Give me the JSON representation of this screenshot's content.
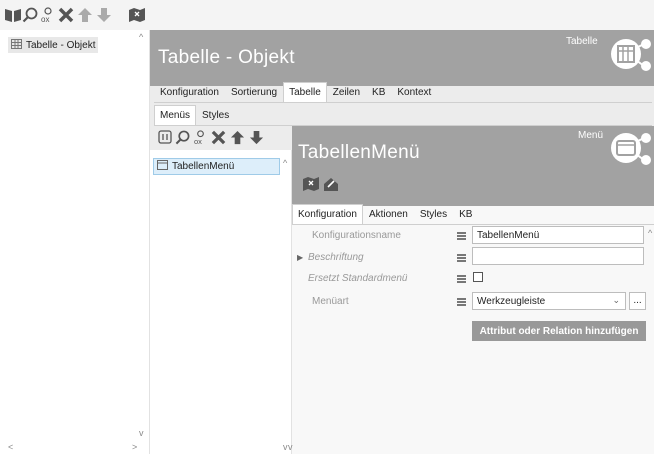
{
  "toolbar": {
    "icons": [
      "book-icon",
      "search-icon",
      "filter-ox-icon",
      "delete-icon",
      "move-up-icon",
      "move-down-icon",
      "map-icon"
    ]
  },
  "tree": {
    "root_label": "Tabelle - Objekt"
  },
  "main": {
    "title": "Tabelle - Objekt",
    "corner_label": "Tabelle",
    "tabs": [
      "Konfiguration",
      "Sortierung",
      "Tabelle",
      "Zeilen",
      "KB",
      "Kontext"
    ],
    "active_tab": "Tabelle",
    "subtabs": [
      "Menüs",
      "Styles"
    ],
    "active_subtab": "Menüs"
  },
  "menu_list": {
    "items": [
      "TabellenMenü"
    ]
  },
  "detail": {
    "title": "TabellenMenü",
    "corner_label": "Menü",
    "tabs": [
      "Konfiguration",
      "Aktionen",
      "Styles",
      "KB"
    ],
    "active_tab": "Konfiguration",
    "properties": [
      {
        "label": "Konfigurationsname",
        "value": "TabellenMenü",
        "type": "text"
      },
      {
        "label": "Beschriftung",
        "value": "",
        "type": "text"
      },
      {
        "label": "Ersetzt Standardmenü",
        "value": "",
        "type": "checkbox"
      },
      {
        "label": "Menüart",
        "value": "Werkzeugleiste",
        "type": "select"
      }
    ],
    "more_button": "...",
    "add_button": "Attribut oder Relation hinzufügen"
  },
  "colors": {
    "header_gray": "#a2a2a2",
    "selection_blue": "#ddeefa",
    "icon_dark": "#555555"
  }
}
